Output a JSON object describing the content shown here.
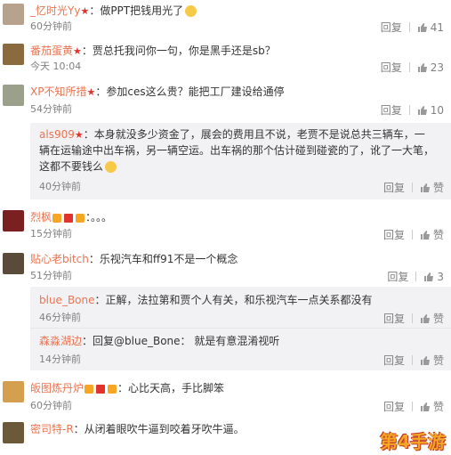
{
  "comments": [
    {
      "user": "_忆时光Yy",
      "text": "：做PPT把钱用光了",
      "time": "60分钟前",
      "reply": "回复",
      "likes": "41"
    },
    {
      "user": "番茄蛋黄",
      "text": "：贾总托我问你一句，你是黑手还是sb？",
      "time": "今天 10:04",
      "reply": "回复",
      "likes": "23"
    },
    {
      "user": "XP不知所措",
      "text": "：参加ces这么贵？能把工厂建设给通停",
      "time": "54分钟前",
      "reply": "回复",
      "likes": "10"
    },
    {
      "user": "烈枫",
      "text": "：。。。",
      "time": "15分钟前",
      "reply": "回复",
      "likes": "赞"
    },
    {
      "user": "贴心老bitch",
      "text": "：乐视汽车和ff91不是一个概念",
      "time": "51分钟前",
      "reply": "回复",
      "likes": "3"
    },
    {
      "user": "皈图炼丹炉",
      "text": "：心比天高，手比脚笨",
      "time": "60分钟前",
      "reply": "回复",
      "likes": "赞"
    },
    {
      "user": "密司特-R",
      "text": "：从闭着眼吹牛逼到咬着牙吹牛逼。",
      "time": "",
      "reply": "",
      "likes": ""
    }
  ],
  "subs": [
    {
      "user": "als909",
      "line1": "：本身就没多少资金了，展会的费用且不说，老贾不是说总共三辆车，一",
      "line2": "辆在运输途中出车祸，另一辆空运。出车祸的那个估计碰到碰瓷的了，讹了一大笔，",
      "line3": "这都不要钱么",
      "time": "40分钟前",
      "reply": "回复",
      "likes": "赞"
    },
    {
      "user": "blue_Bone",
      "text": "：正解，法拉第和贾个人有关，和乐视汽车一点关系都没有",
      "time": "46分钟前",
      "reply": "回复",
      "likes": "赞"
    },
    {
      "user": "森淼湖边",
      "text": "：回复@blue_Bone：  就是有意混淆视听",
      "time": "14分钟前",
      "reply": "回复",
      "likes": "赞"
    }
  ],
  "watermark": "第4手游"
}
